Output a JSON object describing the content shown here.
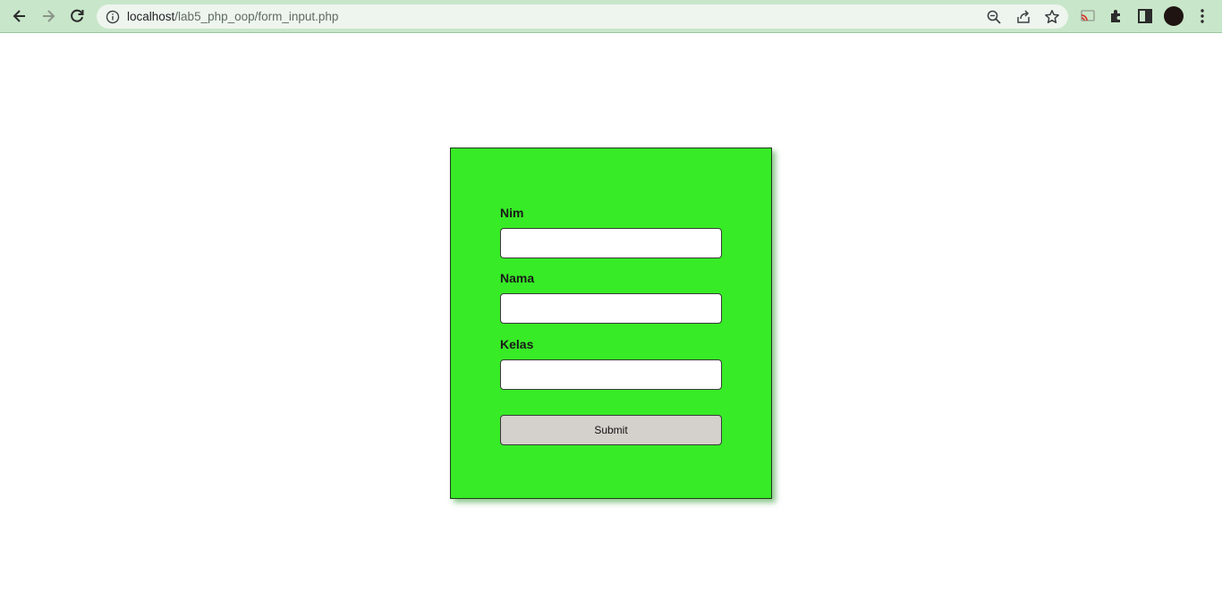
{
  "browser": {
    "url_host": "localhost",
    "url_path": "/lab5_php_oop/form_input.php",
    "icons": {
      "back": "back-arrow-icon",
      "forward": "forward-arrow-icon",
      "reload": "reload-icon",
      "info": "info-icon",
      "zoom": "zoom-icon",
      "share": "share-icon",
      "bookmark": "star-icon",
      "cast": "cast-icon",
      "extensions": "puzzle-icon",
      "side_panel": "side-panel-icon",
      "menu": "kebab-menu-icon"
    }
  },
  "form": {
    "fields": [
      {
        "label": "Nim",
        "value": ""
      },
      {
        "label": "Nama",
        "value": ""
      },
      {
        "label": "Kelas",
        "value": ""
      }
    ],
    "submit_label": "Submit"
  },
  "colors": {
    "card_background": "#37eb26",
    "browser_chrome": "#c8e6c9",
    "button_background": "#d4d0cc"
  }
}
